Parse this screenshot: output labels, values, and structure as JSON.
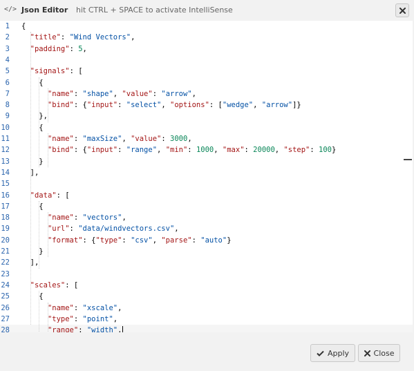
{
  "dialog": {
    "icon": "code-icon",
    "title": "Json Editor",
    "hint": "hit CTRL + SPACE to activate IntelliSense",
    "close_icon": "close-icon"
  },
  "editor": {
    "active_line": 28,
    "lines": [
      {
        "n": "1",
        "t": [
          [
            "p",
            "{"
          ]
        ]
      },
      {
        "n": "2",
        "t": [
          [
            "p",
            "  "
          ],
          [
            "k",
            "\"title\""
          ],
          [
            "p",
            ": "
          ],
          [
            "s",
            "\"Wind Vectors\""
          ],
          [
            "p",
            ","
          ]
        ]
      },
      {
        "n": "3",
        "t": [
          [
            "p",
            "  "
          ],
          [
            "k",
            "\"padding\""
          ],
          [
            "p",
            ": "
          ],
          [
            "n",
            "5"
          ],
          [
            "p",
            ","
          ]
        ]
      },
      {
        "n": "4",
        "t": []
      },
      {
        "n": "5",
        "t": [
          [
            "p",
            "  "
          ],
          [
            "k",
            "\"signals\""
          ],
          [
            "p",
            ": ["
          ]
        ]
      },
      {
        "n": "6",
        "t": [
          [
            "p",
            "    {"
          ]
        ]
      },
      {
        "n": "7",
        "t": [
          [
            "p",
            "      "
          ],
          [
            "k",
            "\"name\""
          ],
          [
            "p",
            ": "
          ],
          [
            "s",
            "\"shape\""
          ],
          [
            "p",
            ", "
          ],
          [
            "k",
            "\"value\""
          ],
          [
            "p",
            ": "
          ],
          [
            "s",
            "\"arrow\""
          ],
          [
            "p",
            ","
          ]
        ]
      },
      {
        "n": "8",
        "t": [
          [
            "p",
            "      "
          ],
          [
            "k",
            "\"bind\""
          ],
          [
            "p",
            ": {"
          ],
          [
            "k",
            "\"input\""
          ],
          [
            "p",
            ": "
          ],
          [
            "s",
            "\"select\""
          ],
          [
            "p",
            ", "
          ],
          [
            "k",
            "\"options\""
          ],
          [
            "p",
            ": ["
          ],
          [
            "s",
            "\"wedge\""
          ],
          [
            "p",
            ", "
          ],
          [
            "s",
            "\"arrow\""
          ],
          [
            "p",
            "]}"
          ]
        ]
      },
      {
        "n": "9",
        "t": [
          [
            "p",
            "    },"
          ]
        ]
      },
      {
        "n": "10",
        "t": [
          [
            "p",
            "    {"
          ]
        ]
      },
      {
        "n": "11",
        "t": [
          [
            "p",
            "      "
          ],
          [
            "k",
            "\"name\""
          ],
          [
            "p",
            ": "
          ],
          [
            "s",
            "\"maxSize\""
          ],
          [
            "p",
            ", "
          ],
          [
            "k",
            "\"value\""
          ],
          [
            "p",
            ": "
          ],
          [
            "n",
            "3000"
          ],
          [
            "p",
            ","
          ]
        ]
      },
      {
        "n": "12",
        "t": [
          [
            "p",
            "      "
          ],
          [
            "k",
            "\"bind\""
          ],
          [
            "p",
            ": {"
          ],
          [
            "k",
            "\"input\""
          ],
          [
            "p",
            ": "
          ],
          [
            "s",
            "\"range\""
          ],
          [
            "p",
            ", "
          ],
          [
            "k",
            "\"min\""
          ],
          [
            "p",
            ": "
          ],
          [
            "n",
            "1000"
          ],
          [
            "p",
            ", "
          ],
          [
            "k",
            "\"max\""
          ],
          [
            "p",
            ": "
          ],
          [
            "n",
            "20000"
          ],
          [
            "p",
            ", "
          ],
          [
            "k",
            "\"step\""
          ],
          [
            "p",
            ": "
          ],
          [
            "n",
            "100"
          ],
          [
            "p",
            "}"
          ]
        ]
      },
      {
        "n": "13",
        "t": [
          [
            "p",
            "    }"
          ]
        ]
      },
      {
        "n": "14",
        "t": [
          [
            "p",
            "  ],"
          ]
        ]
      },
      {
        "n": "15",
        "t": []
      },
      {
        "n": "16",
        "t": [
          [
            "p",
            "  "
          ],
          [
            "k",
            "\"data\""
          ],
          [
            "p",
            ": ["
          ]
        ]
      },
      {
        "n": "17",
        "t": [
          [
            "p",
            "    {"
          ]
        ]
      },
      {
        "n": "18",
        "t": [
          [
            "p",
            "      "
          ],
          [
            "k",
            "\"name\""
          ],
          [
            "p",
            ": "
          ],
          [
            "s",
            "\"vectors\""
          ],
          [
            "p",
            ","
          ]
        ]
      },
      {
        "n": "19",
        "t": [
          [
            "p",
            "      "
          ],
          [
            "k",
            "\"url\""
          ],
          [
            "p",
            ": "
          ],
          [
            "s",
            "\"data/windvectors.csv\""
          ],
          [
            "p",
            ","
          ]
        ]
      },
      {
        "n": "20",
        "t": [
          [
            "p",
            "      "
          ],
          [
            "k",
            "\"format\""
          ],
          [
            "p",
            ": {"
          ],
          [
            "k",
            "\"type\""
          ],
          [
            "p",
            ": "
          ],
          [
            "s",
            "\"csv\""
          ],
          [
            "p",
            ", "
          ],
          [
            "k",
            "\"parse\""
          ],
          [
            "p",
            ": "
          ],
          [
            "s",
            "\"auto\""
          ],
          [
            "p",
            "}"
          ]
        ]
      },
      {
        "n": "21",
        "t": [
          [
            "p",
            "    }"
          ]
        ]
      },
      {
        "n": "22",
        "t": [
          [
            "p",
            "  ],"
          ]
        ]
      },
      {
        "n": "23",
        "t": []
      },
      {
        "n": "24",
        "t": [
          [
            "p",
            "  "
          ],
          [
            "k",
            "\"scales\""
          ],
          [
            "p",
            ": ["
          ]
        ]
      },
      {
        "n": "25",
        "t": [
          [
            "p",
            "    {"
          ]
        ]
      },
      {
        "n": "26",
        "t": [
          [
            "p",
            "      "
          ],
          [
            "k",
            "\"name\""
          ],
          [
            "p",
            ": "
          ],
          [
            "s",
            "\"xscale\""
          ],
          [
            "p",
            ","
          ]
        ]
      },
      {
        "n": "27",
        "t": [
          [
            "p",
            "      "
          ],
          [
            "k",
            "\"type\""
          ],
          [
            "p",
            ": "
          ],
          [
            "s",
            "\"point\""
          ],
          [
            "p",
            ","
          ]
        ]
      },
      {
        "n": "28",
        "t": [
          [
            "p",
            "      "
          ],
          [
            "k",
            "\"range\""
          ],
          [
            "p",
            ": "
          ],
          [
            "s",
            "\"width\""
          ],
          [
            "p",
            ","
          ]
        ]
      }
    ]
  },
  "footer": {
    "apply_label": "Apply",
    "apply_icon": "check-icon",
    "close_label": "Close",
    "close_icon": "close-icon"
  },
  "colors": {
    "key": "#a31515",
    "string": "#0451a5",
    "number": "#098658",
    "line_number": "#2a64ad",
    "background": "#f2f2f2"
  }
}
